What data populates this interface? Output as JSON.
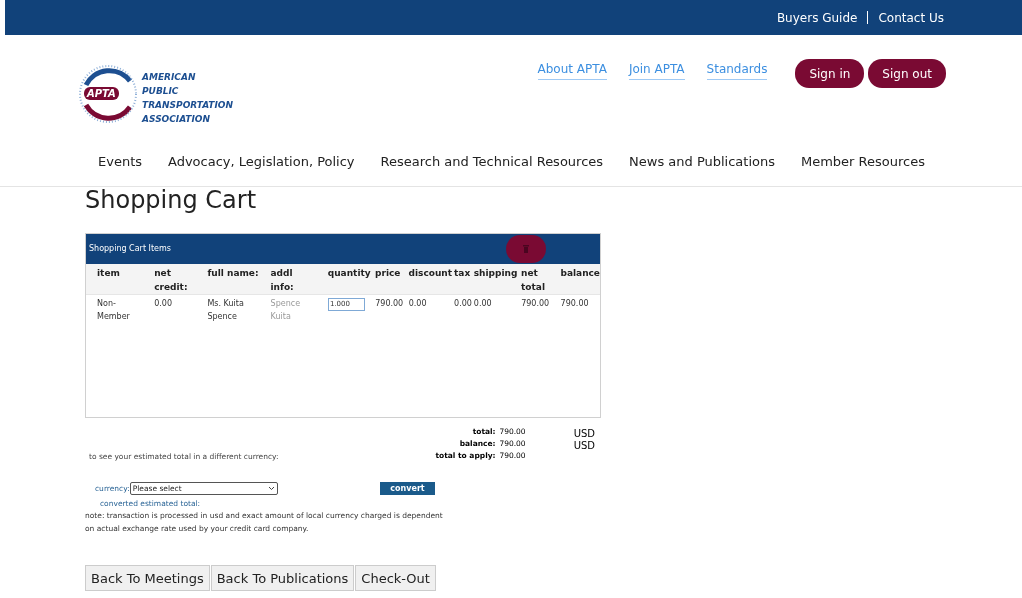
{
  "top_bar": {
    "links": [
      "Buyers Guide",
      "Contact Us"
    ]
  },
  "logo": {
    "badge": "APTA",
    "lines": [
      "AMERICAN",
      "PUBLIC",
      "TRANSPORTATION",
      "ASSOCIATION"
    ]
  },
  "header_links": [
    "About APTA",
    "Join APTA",
    "Standards"
  ],
  "auth_buttons": [
    "Sign in",
    "Sign out"
  ],
  "nav": [
    "Events",
    "Advocacy, Legislation, Policy",
    "Research and Technical Resources",
    "News and Publications",
    "Member Resources"
  ],
  "page_title": "Shopping Cart",
  "cart": {
    "title": "Shopping Cart Items",
    "columns": [
      "item",
      "net credit:",
      "full name:",
      "addl info:",
      "quantity",
      "price",
      "discount",
      "tax",
      "shipping",
      "net total",
      "balance"
    ],
    "rows": [
      {
        "item": "Non-Member",
        "net_credit": "0.00",
        "full_name": "Ms. Kuita Spence",
        "addl_info": "Spence Kuita",
        "quantity": "1.000",
        "price": "790.00",
        "discount": "0.00",
        "tax": "0.00",
        "shipping": "0.00",
        "net_total": "790.00",
        "balance": "790.00"
      }
    ]
  },
  "totals": [
    {
      "label": "total:",
      "value": "790.00",
      "currency": "USD"
    },
    {
      "label": "balance:",
      "value": "790.00",
      "currency": "USD"
    },
    {
      "label": "total to apply:",
      "value": "790.00"
    }
  ],
  "currency_hint": "to see your estimated total in a different currency:",
  "currency": {
    "label": "currency:",
    "placeholder": "Please select",
    "button": "convert",
    "converted_label": "converted estimated total:"
  },
  "note": "note: transaction is processed in usd and exact amount of local currency charged is dependent on actual exchange rate used by your credit card company.",
  "bottom_buttons": [
    "Back To Meetings",
    "Back To Publications",
    "Check-Out"
  ]
}
